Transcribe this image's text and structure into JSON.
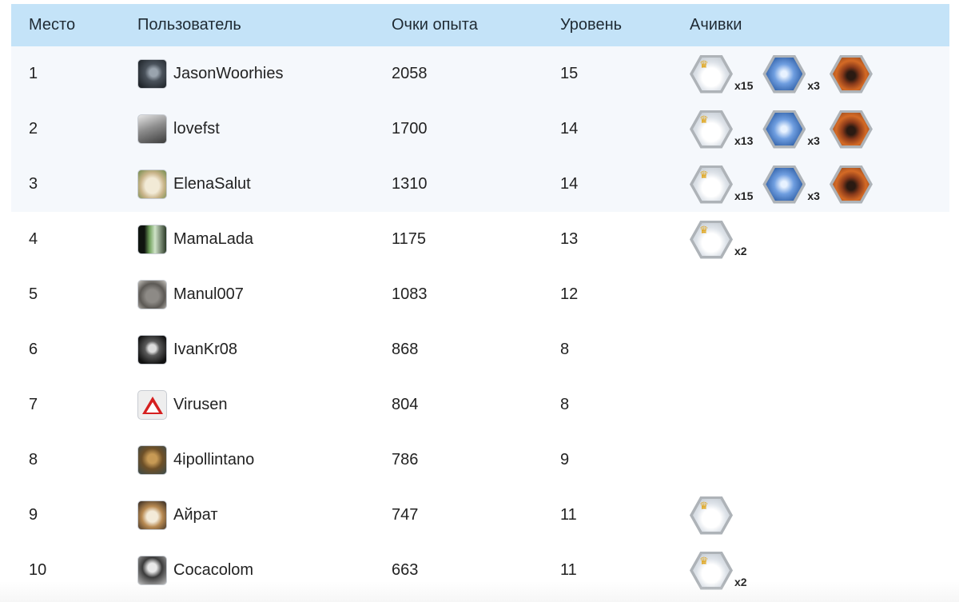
{
  "headers": {
    "place": "Место",
    "user": "Пользователь",
    "xp": "Очки опыта",
    "level": "Уровень",
    "achievements": "Ачивки"
  },
  "rows": [
    {
      "place": "1",
      "user": "JasonWoorhies",
      "xp": "2058",
      "level": "15",
      "achievements": [
        {
          "icon": "snowball-badge-icon",
          "count": "x15"
        },
        {
          "icon": "ice-badge-icon",
          "count": "x3"
        },
        {
          "icon": "bear-badge-icon",
          "count": ""
        }
      ]
    },
    {
      "place": "2",
      "user": "lovefst",
      "xp": "1700",
      "level": "14",
      "achievements": [
        {
          "icon": "snowball-badge-icon",
          "count": "x13"
        },
        {
          "icon": "ice-badge-icon",
          "count": "x3"
        },
        {
          "icon": "bear-badge-icon",
          "count": ""
        }
      ]
    },
    {
      "place": "3",
      "user": "ElenaSalut",
      "xp": "1310",
      "level": "14",
      "achievements": [
        {
          "icon": "snowball-badge-icon",
          "count": "x15"
        },
        {
          "icon": "ice-badge-icon",
          "count": "x3"
        },
        {
          "icon": "bear-badge-icon",
          "count": ""
        }
      ]
    },
    {
      "place": "4",
      "user": "MamaLada",
      "xp": "1175",
      "level": "13",
      "achievements": [
        {
          "icon": "snowball-badge-icon",
          "count": "x2"
        }
      ]
    },
    {
      "place": "5",
      "user": "Manul007",
      "xp": "1083",
      "level": "12",
      "achievements": []
    },
    {
      "place": "6",
      "user": "IvanKr08",
      "xp": "868",
      "level": "8",
      "achievements": []
    },
    {
      "place": "7",
      "user": "Virusen",
      "xp": "804",
      "level": "8",
      "achievements": []
    },
    {
      "place": "8",
      "user": "4ipollintano",
      "xp": "786",
      "level": "9",
      "achievements": []
    },
    {
      "place": "9",
      "user": "Айрат",
      "xp": "747",
      "level": "11",
      "achievements": [
        {
          "icon": "snowball-badge-icon",
          "count": ""
        }
      ]
    },
    {
      "place": "10",
      "user": "Cocacolom",
      "xp": "663",
      "level": "11",
      "achievements": [
        {
          "icon": "snowball-badge-icon",
          "count": "x2"
        }
      ]
    }
  ],
  "colors": {
    "header_bg": "#c4e3f8",
    "top_rows_bg": "#f5f8fc"
  }
}
